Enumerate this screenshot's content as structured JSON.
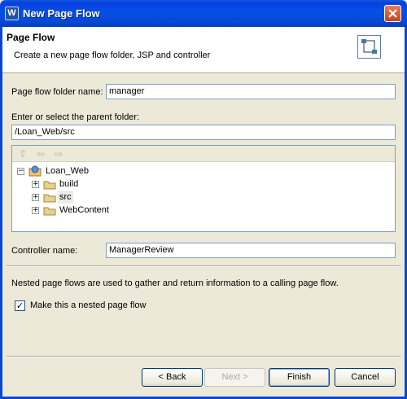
{
  "window": {
    "title": "New Page Flow",
    "app_icon_letter": "W"
  },
  "banner": {
    "title": "Page Flow",
    "description": "Create a new page flow folder, JSP and controller"
  },
  "form": {
    "folder_name_label": "Page flow folder name:",
    "folder_name_value": "manager",
    "parent_folder_label": "Enter or select the parent folder:",
    "parent_folder_value": "/Loan_Web/src",
    "controller_name_label": "Controller name:",
    "controller_name_value": "ManagerReview",
    "nested_description": "Nested page flows are used to gather and return information to a calling page flow.",
    "nested_checkbox_label": "Make this a nested page flow",
    "nested_checked": true
  },
  "tree": {
    "root": {
      "label": "Loan_Web",
      "expander": "−"
    },
    "children": [
      {
        "label": "build",
        "expander": "+"
      },
      {
        "label": "src",
        "expander": "+",
        "selected": true
      },
      {
        "label": "WebContent",
        "expander": "+"
      }
    ],
    "toolbar_icons": [
      "up-folder-icon",
      "back-arrow-icon",
      "forward-arrow-icon"
    ]
  },
  "buttons": {
    "back": "< Back",
    "next": "Next >",
    "finish": "Finish",
    "cancel": "Cancel"
  }
}
